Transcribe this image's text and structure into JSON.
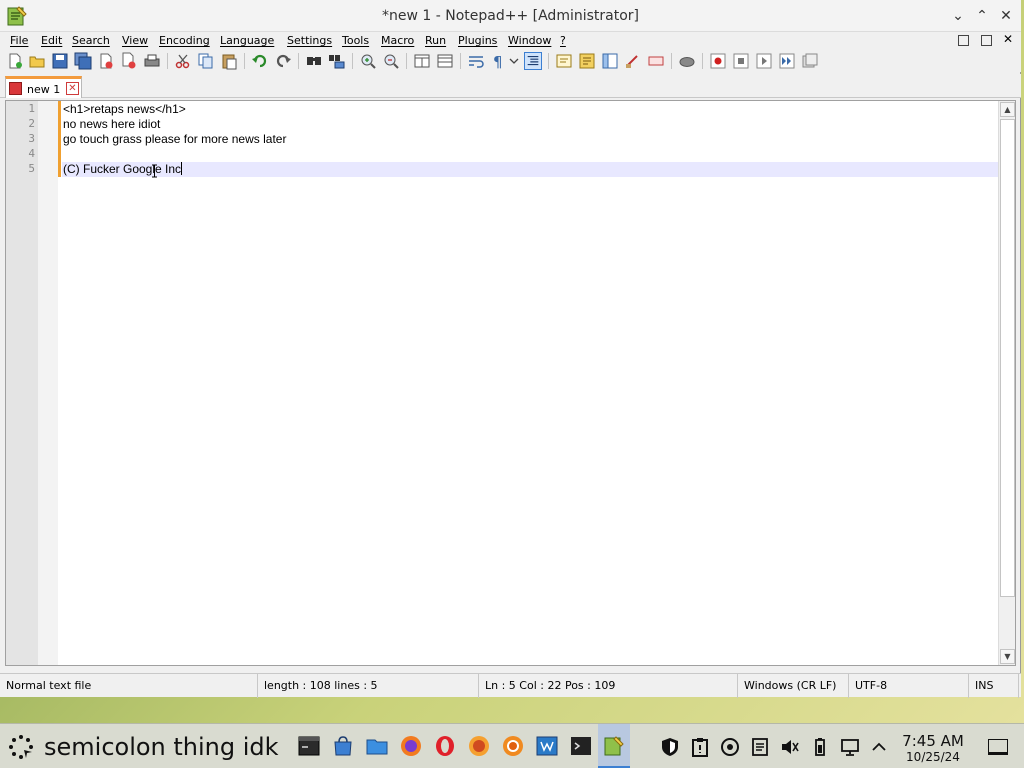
{
  "window": {
    "title": "*new 1 - Notepad++ [Administrator]",
    "controls": {
      "minimize": "⌄",
      "maximize": "⌃",
      "close": "✕"
    }
  },
  "menu": {
    "items": [
      {
        "label": "File"
      },
      {
        "label": "Edit"
      },
      {
        "label": "Search"
      },
      {
        "label": "View"
      },
      {
        "label": "Encoding"
      },
      {
        "label": "Language"
      },
      {
        "label": "Settings"
      },
      {
        "label": "Tools"
      },
      {
        "label": "Macro"
      },
      {
        "label": "Run"
      },
      {
        "label": "Plugins"
      },
      {
        "label": "Window"
      },
      {
        "label": "?"
      }
    ]
  },
  "toolbar": {
    "icons": [
      "new-file-icon",
      "open-file-icon",
      "save-icon",
      "save-all-icon",
      "close-icon",
      "close-all-icon",
      "print-icon",
      "cut-icon",
      "copy-icon",
      "paste-icon",
      "undo-icon",
      "redo-icon",
      "find-icon",
      "replace-icon",
      "zoom-in-icon",
      "zoom-out-icon",
      "sync-vertical-icon",
      "sync-horizontal-icon",
      "word-wrap-icon",
      "show-all-chars-icon",
      "indent-guide-icon",
      "user-language-icon",
      "doc-map-icon",
      "function-list-icon",
      "folder-workspace-icon",
      "monitoring-icon",
      "record-macro-icon",
      "stop-macro-icon",
      "play-macro-icon",
      "run-macro-multiple-icon",
      "save-macro-icon"
    ]
  },
  "tabs": [
    {
      "label": "new 1",
      "modified": true
    }
  ],
  "editor": {
    "lines": [
      {
        "num": "1",
        "text": "<h1>retaps news</h1>"
      },
      {
        "num": "2",
        "text": "no news here idiot"
      },
      {
        "num": "3",
        "text": "go touch grass please for more news later"
      },
      {
        "num": "4",
        "text": ""
      },
      {
        "num": "5",
        "text": "(C) Fucker Google Inc"
      }
    ],
    "current_line": 5
  },
  "status": {
    "file_type": "Normal text file",
    "length_lines": "length : 108    lines : 5",
    "position": "Ln : 5    Col : 22    Pos : 109",
    "eol": "Windows (CR LF)",
    "encoding": "UTF-8",
    "mode": "INS"
  },
  "taskbar": {
    "start_label": "semicolon thing idk",
    "apps": [
      "terminal-icon",
      "store-icon",
      "file-manager-icon",
      "firefox-icon",
      "opera-icon",
      "firefox-alt-icon",
      "browser-icon",
      "app-window-icon",
      "console-icon",
      "notepadpp-icon"
    ],
    "tray": [
      "shield-icon",
      "clipboard-icon",
      "update-icon",
      "notes-icon",
      "volume-muted-icon",
      "battery-icon",
      "network-icon",
      "chevron-up-icon"
    ],
    "time": "7:45 AM",
    "date": "10/25/24"
  }
}
